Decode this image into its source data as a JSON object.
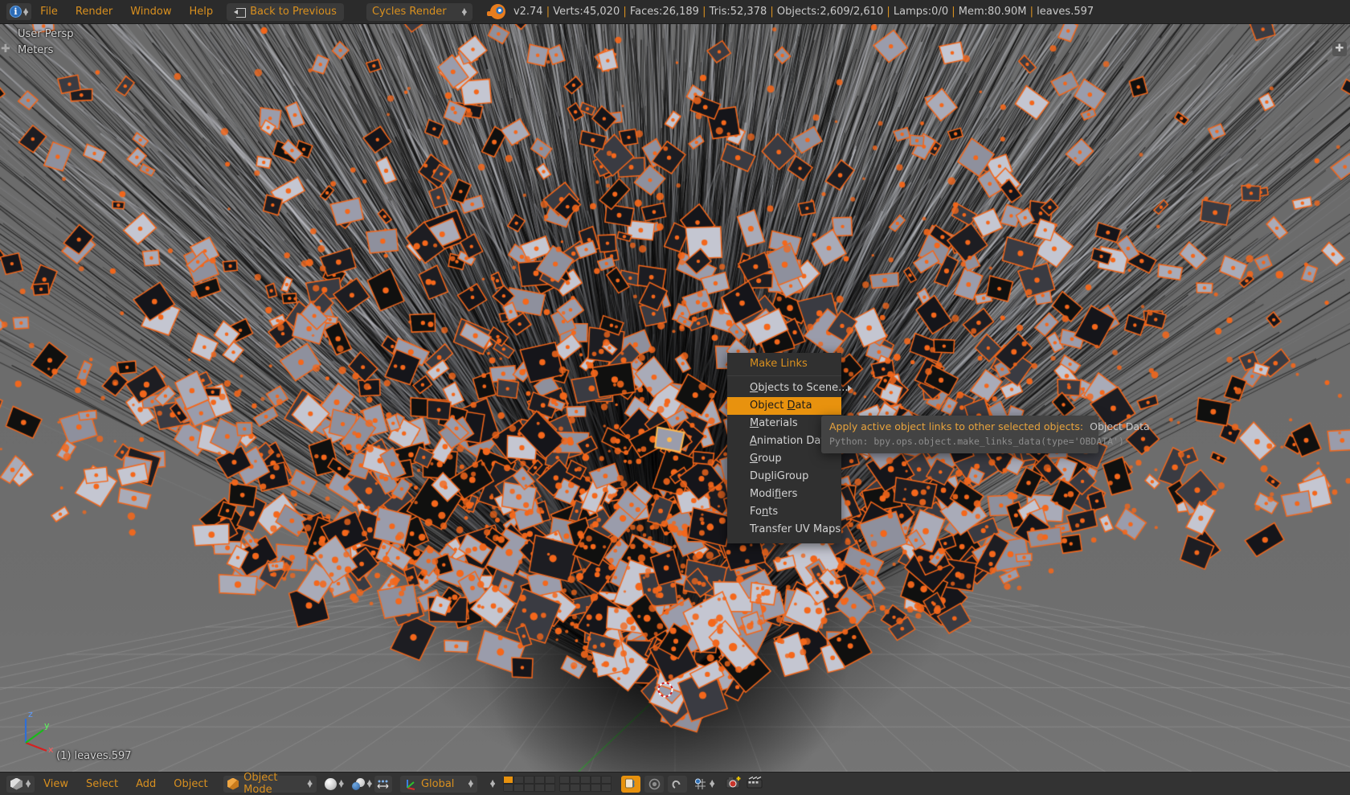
{
  "topbar": {
    "editor_type_icon": "info-editor-icon",
    "menus": [
      "File",
      "Render",
      "Window",
      "Help"
    ],
    "back_button": "Back to Previous",
    "render_engine": "Cycles Render",
    "blender_logo": "blender-logo-icon",
    "stats": {
      "version": "v2.74",
      "verts": "Verts:45,020",
      "faces": "Faces:26,189",
      "tris": "Tris:52,378",
      "objects": "Objects:2,609/2,610",
      "lamps": "Lamps:0/0",
      "mem": "Mem:80.90M",
      "active_object": "leaves.597",
      "separator": "|"
    }
  },
  "viewport": {
    "view_name": "User Persp",
    "units": "Meters",
    "active_object_label": "(1) leaves.597",
    "axis_gizmo": {
      "x": "x",
      "y": "y",
      "z": "z"
    },
    "cursor": "3d-cursor",
    "background_color": "#6b6b6b",
    "selection_color": "#f4671b",
    "active_color": "#ffb84d"
  },
  "make_links_menu": {
    "title": "Make Links",
    "items": [
      {
        "label": "Objects to Scene...",
        "accel": "O",
        "submenu": true,
        "active": false
      },
      {
        "label": "Object Data",
        "accel": "D",
        "submenu": false,
        "active": true
      },
      {
        "label": "Materials",
        "accel": "M",
        "submenu": false,
        "active": false
      },
      {
        "label": "Animation Data",
        "accel": "A",
        "submenu": false,
        "active": false
      },
      {
        "label": "Group",
        "accel": "G",
        "submenu": false,
        "active": false
      },
      {
        "label": "DupliGroup",
        "accel": "p",
        "submenu": false,
        "active": false
      },
      {
        "label": "Modifiers",
        "accel": "f",
        "submenu": false,
        "active": false
      },
      {
        "label": "Fonts",
        "accel": "n",
        "submenu": false,
        "active": false
      },
      {
        "label": "Transfer UV Maps",
        "accel": "",
        "submenu": false,
        "active": false
      }
    ],
    "highlight_color": "#e8920e"
  },
  "tooltip": {
    "description": "Apply active object links to other selected objects:",
    "value": "Object Data",
    "python": "Python: bpy.ops.object.make_links_data(type='OBDATA')"
  },
  "bottombar": {
    "editor_type_icon": "3d-view-editor-icon",
    "menus": [
      "View",
      "Select",
      "Add",
      "Object"
    ],
    "mode": "Object Mode",
    "viewport_shading": "solid-shading-icon",
    "scene_options_icon": "render-shading-icon",
    "pivot_icon": "manipulator-pivot-icon",
    "transform_orientation": "Global",
    "layers_icon": "scene-layers",
    "proportional_edit_icon": "proportional-edit-icon",
    "snap_magnet_icon": "snap-magnet-icon",
    "snap_target_icon": "snap-increment-icon",
    "render_camera_icon": "render-still-icon",
    "render_animation_icon": "render-animation-icon",
    "active_layer_index": 0
  }
}
